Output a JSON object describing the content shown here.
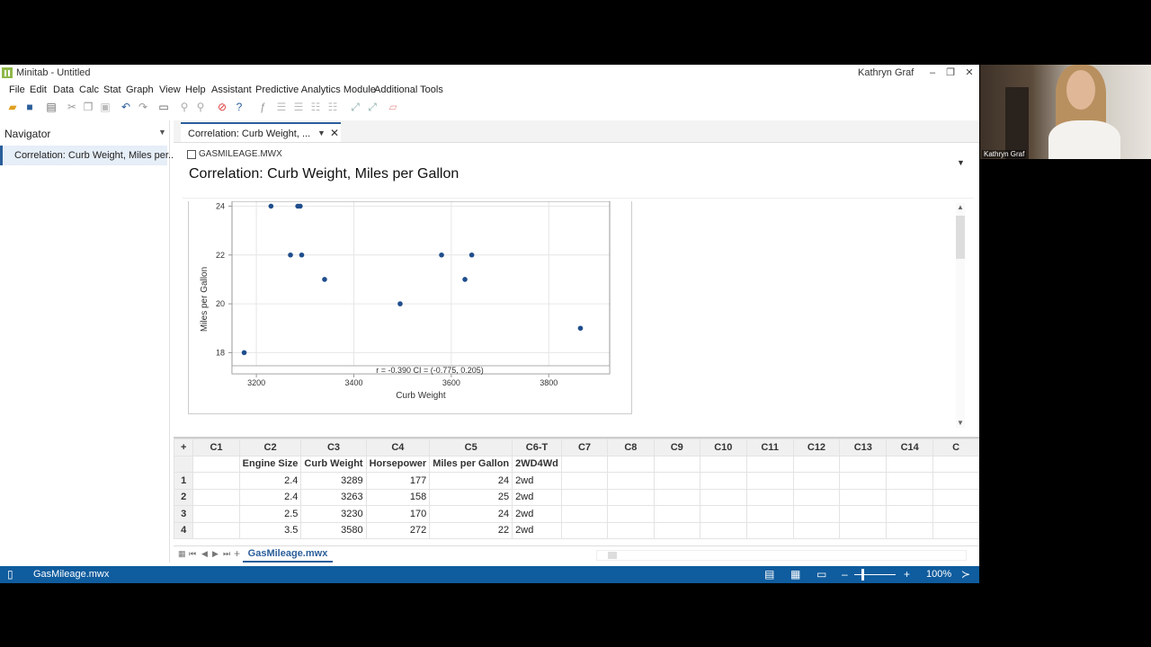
{
  "window": {
    "title": "Minitab - Untitled",
    "user": "Kathryn Graf",
    "controls": [
      "–",
      "❐",
      "✕"
    ]
  },
  "menu": [
    "File",
    "Edit",
    "Data",
    "Calc",
    "Stat",
    "Graph",
    "View",
    "Help",
    "Assistant",
    "Predictive Analytics Module",
    "Additional Tools"
  ],
  "navigator": {
    "title": "Navigator",
    "items": [
      "Correlation: Curb Weight, Miles per..."
    ]
  },
  "output": {
    "tab_label": "Correlation: Curb Weight, ...",
    "file_name": "GASMILEAGE.MWX",
    "title": "Correlation: Curb Weight, Miles per Gallon"
  },
  "chart_data": {
    "type": "scatter",
    "xlabel": "Curb Weight",
    "ylabel": "Miles per Gallon",
    "annotation": "r = -0.390  CI = (-0.775, 0.205)",
    "xlim": [
      3150,
      3925
    ],
    "ylim": [
      17.5,
      24.2
    ],
    "xticks": [
      3200,
      3400,
      3600,
      3800
    ],
    "yticks": [
      18,
      20,
      22,
      24
    ],
    "grid": true,
    "color": "#1f4e8c",
    "points": [
      {
        "x": 3175,
        "y": 18
      },
      {
        "x": 3230,
        "y": 24
      },
      {
        "x": 3270,
        "y": 22
      },
      {
        "x": 3285,
        "y": 24
      },
      {
        "x": 3290,
        "y": 24
      },
      {
        "x": 3293,
        "y": 22
      },
      {
        "x": 3340,
        "y": 21
      },
      {
        "x": 3495,
        "y": 20
      },
      {
        "x": 3580,
        "y": 22
      },
      {
        "x": 3628,
        "y": 21
      },
      {
        "x": 3642,
        "y": 22
      },
      {
        "x": 3865,
        "y": 19
      }
    ]
  },
  "worksheet": {
    "columns": [
      "C1",
      "C2",
      "C3",
      "C4",
      "C5",
      "C6-T",
      "C7",
      "C8",
      "C9",
      "C10",
      "C11",
      "C12",
      "C13",
      "C14",
      "C"
    ],
    "names": [
      "",
      "Engine Size",
      "Curb Weight",
      "Horsepower",
      "Miles per Gallon",
      "2WD4Wd",
      "",
      "",
      "",
      "",
      "",
      "",
      "",
      "",
      ""
    ],
    "rows": [
      {
        "n": "1",
        "c2": "2.4",
        "c3": "3289",
        "c4": "177",
        "c5": "24",
        "c6": "2wd"
      },
      {
        "n": "2",
        "c2": "2.4",
        "c3": "3263",
        "c4": "158",
        "c5": "25",
        "c6": "2wd"
      },
      {
        "n": "3",
        "c2": "2.5",
        "c3": "3230",
        "c4": "170",
        "c5": "24",
        "c6": "2wd"
      },
      {
        "n": "4",
        "c2": "3.5",
        "c3": "3580",
        "c4": "272",
        "c5": "22",
        "c6": "2wd"
      }
    ],
    "sheet_tab": "GasMileage.mwx"
  },
  "status": {
    "file": "GasMileage.mwx",
    "zoom": "100%"
  },
  "video": {
    "name": "Kathryn Graf"
  }
}
